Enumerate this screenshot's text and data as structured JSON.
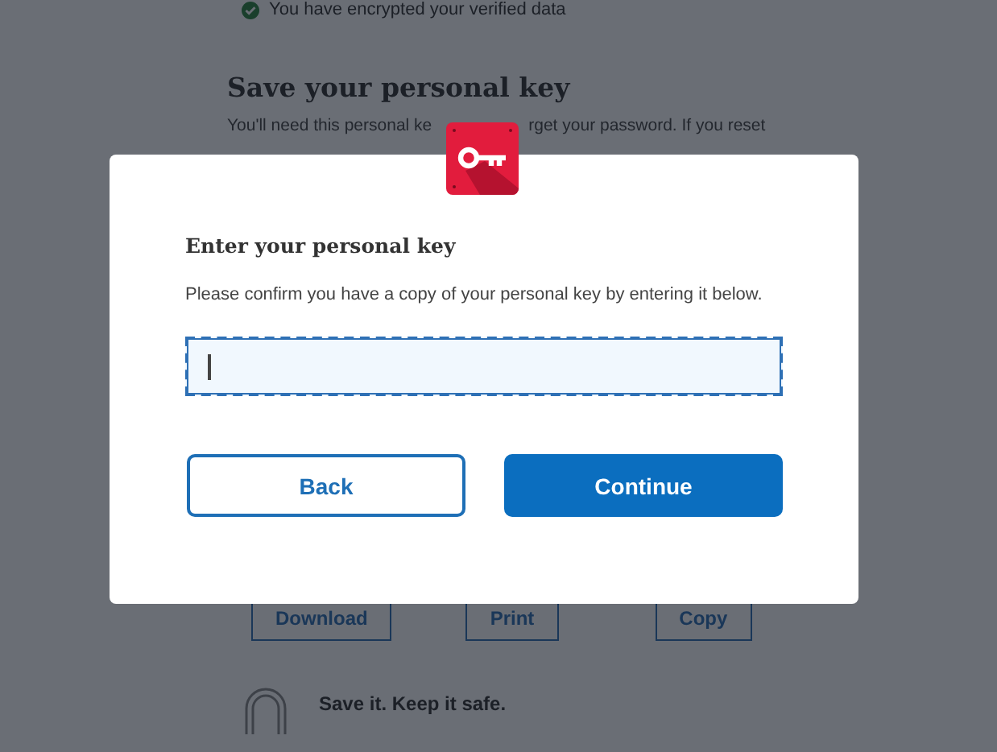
{
  "background_page": {
    "status": {
      "text": "You have encrypted your verified data",
      "done": true
    },
    "title": "Save your personal key",
    "intro_parts": [
      "You'll need this personal ke",
      "rget your password. If you reset"
    ],
    "buttons": [
      "Download",
      "Print",
      "Copy"
    ],
    "tip": {
      "title": "Save it. Keep it safe."
    }
  },
  "dialog": {
    "title": "Enter your personal key",
    "description": "Please confirm you have a copy of your personal key by entering it below.",
    "field": {
      "focused": true
    },
    "buttons": [
      {
        "label": "Back",
        "kind": "secondary"
      },
      {
        "label": "Continue",
        "kind": "primary"
      }
    ]
  }
}
